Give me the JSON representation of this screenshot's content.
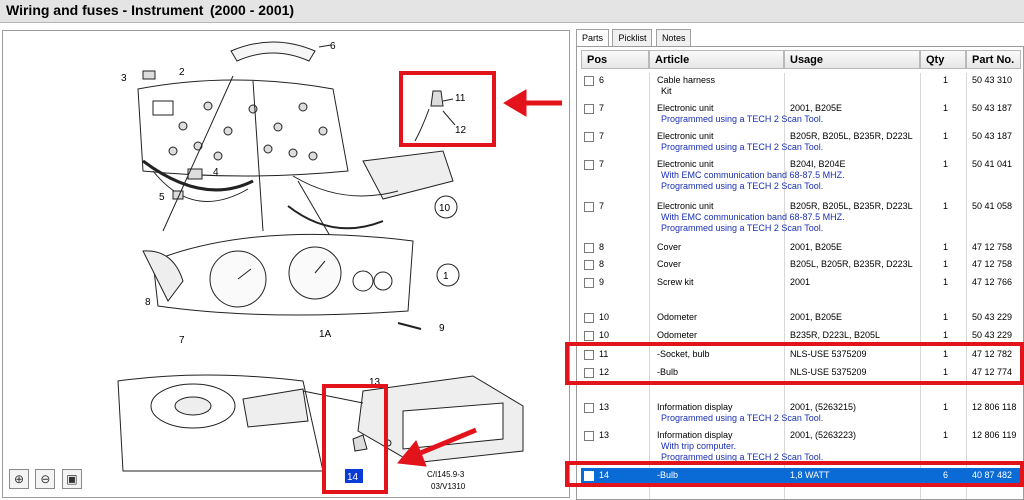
{
  "title": {
    "text": "Wiring and fuses - Instrument",
    "years": "(2000 - 2001)"
  },
  "tabs": [
    "Parts",
    "Picklist",
    "Notes"
  ],
  "columns": [
    "Pos",
    "Article",
    "Usage",
    "Qty",
    "Part No."
  ],
  "rows": [
    {
      "pos": "6",
      "article": "Cable harness",
      "usage": "",
      "qty": "1",
      "part": "50 43 310",
      "extra": "Kit",
      "notes": []
    },
    {
      "pos": "7",
      "article": "Electronic unit",
      "usage": "2001, B205E",
      "qty": "1",
      "part": "50 43 187",
      "notes": [
        "Programmed using a TECH 2 Scan Tool."
      ]
    },
    {
      "pos": "7",
      "article": "Electronic unit",
      "usage": "B205R, B205L, B235R, D223L",
      "qty": "1",
      "part": "50 43 187",
      "notes": [
        "Programmed using a TECH 2 Scan Tool."
      ]
    },
    {
      "pos": "7",
      "article": "Electronic unit",
      "usage": "B204I, B204E",
      "qty": "1",
      "part": "50 41 041",
      "notes": [
        "With EMC communication band 68-87.5 MHZ.",
        "Programmed using a TECH 2 Scan Tool."
      ]
    },
    {
      "pos": "7",
      "article": "Electronic unit",
      "usage": "B205R, B205L, B235R, D223L",
      "qty": "1",
      "part": "50 41 058",
      "notes": [
        "With EMC communication band 68-87.5 MHZ.",
        "Programmed using a TECH 2 Scan Tool."
      ]
    },
    {
      "pos": "8",
      "article": "Cover",
      "usage": "2001, B205E",
      "qty": "1",
      "part": "47 12 758",
      "notes": []
    },
    {
      "pos": "8",
      "article": "Cover",
      "usage": "B205L, B205R, B235R, D223L",
      "qty": "1",
      "part": "47 12 758",
      "notes": []
    },
    {
      "pos": "9",
      "article": "Screw kit",
      "usage": "2001",
      "qty": "1",
      "part": "47 12 766",
      "notes": []
    },
    {
      "pos": "10",
      "article": "Odometer",
      "usage": "2001, B205E",
      "qty": "1",
      "part": "50 43 229",
      "notes": []
    },
    {
      "pos": "10",
      "article": "Odometer",
      "usage": "B235R, D223L, B205L",
      "qty": "1",
      "part": "50 43 229",
      "notes": []
    },
    {
      "pos": "11",
      "article": "-Socket, bulb",
      "usage": "NLS-USE 5375209",
      "qty": "1",
      "part": "47 12 782",
      "notes": []
    },
    {
      "pos": "12",
      "article": "-Bulb",
      "usage": "NLS-USE 5375209",
      "qty": "1",
      "part": "47 12 774",
      "notes": []
    },
    {
      "pos": "13",
      "article": "Information display",
      "usage": "2001, (5263215)",
      "qty": "1",
      "part": "12 806 118",
      "notes": [
        "Programmed using a TECH 2 Scan Tool."
      ]
    },
    {
      "pos": "13",
      "article": "Information display",
      "usage": "2001, (5263223)",
      "qty": "1",
      "part": "12 806 119",
      "notes": [
        "With trip computer.",
        "Programmed using a TECH 2 Scan Tool."
      ]
    },
    {
      "pos": "14",
      "article": "-Bulb",
      "usage": "1,8 WATT",
      "qty": "6",
      "part": "40 87 482",
      "notes": [],
      "selected": true
    }
  ],
  "diagram": {
    "callouts": [
      "1",
      "1A",
      "2",
      "3",
      "4",
      "5",
      "6",
      "7",
      "8",
      "9",
      "10",
      "11",
      "12",
      "13",
      "14"
    ],
    "code": "C/I145.9-3",
    "code2": "03/V1310"
  },
  "zoom_icons": [
    "zoom-in-icon",
    "zoom-out-icon",
    "fit-icon"
  ],
  "highlight_color": "#e3131b",
  "selected_color": "#0a6ad6"
}
